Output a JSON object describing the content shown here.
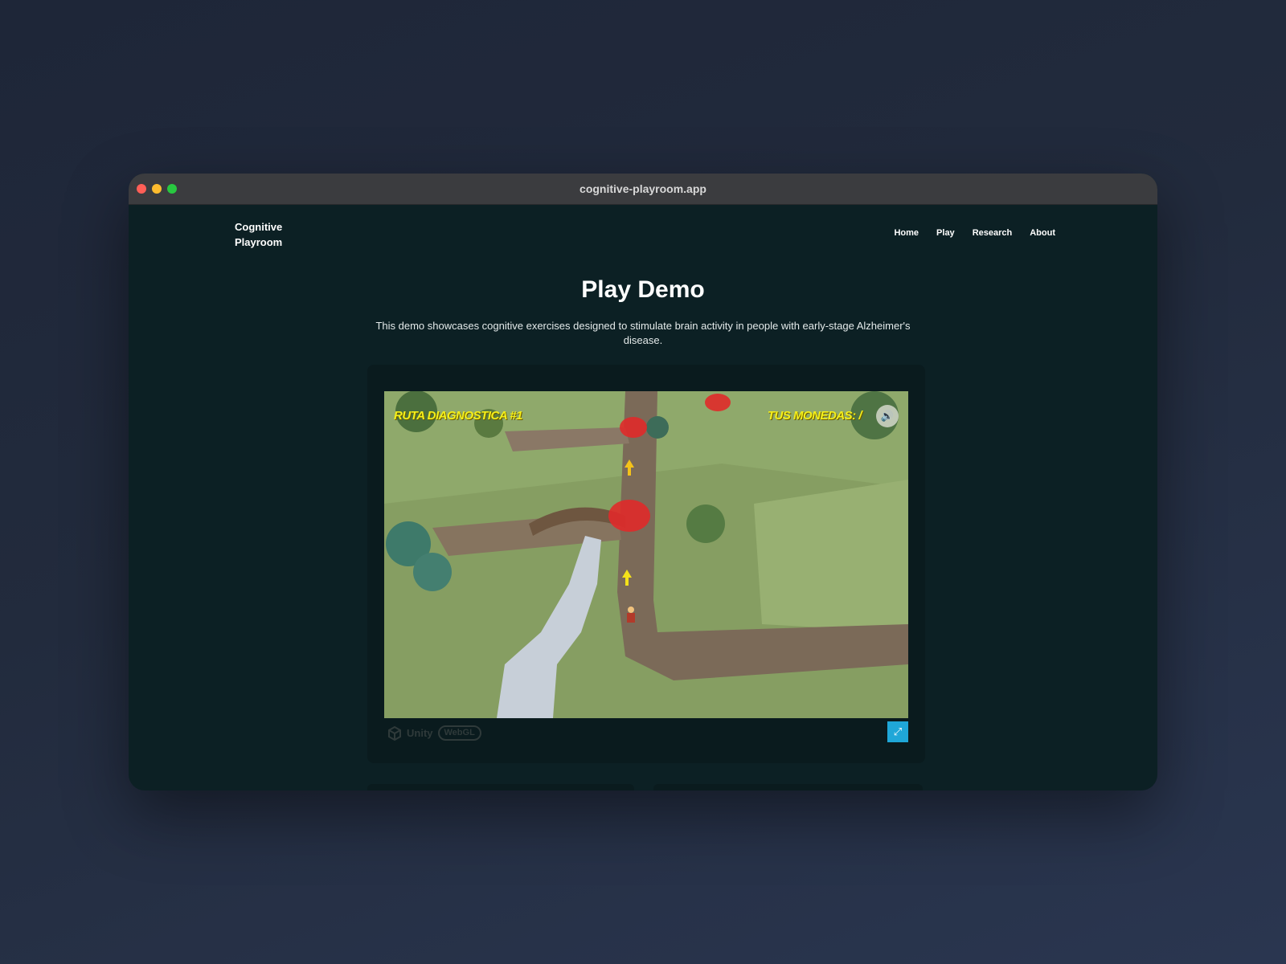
{
  "browser": {
    "url": "cognitive-playroom.app"
  },
  "header": {
    "logo_line1": "Cognitive",
    "logo_line2": "Playroom",
    "nav": [
      {
        "label": "Home"
      },
      {
        "label": "Play"
      },
      {
        "label": "Research"
      },
      {
        "label": "About"
      }
    ]
  },
  "main": {
    "title": "Play Demo",
    "description": "This demo showcases cognitive exercises designed to stimulate brain activity in people with early-stage Alzheimer's disease."
  },
  "game": {
    "hud_left": "RUTA DIAGNOSTICA #1",
    "hud_right": "TUS MONEDAS: /",
    "sound_icon": "speaker-icon",
    "footer_unity": "Unity",
    "footer_webgl": "WebGL",
    "fullscreen_icon": "fullscreen-icon"
  },
  "colors": {
    "page_bg": "#0c2024",
    "hud_text": "#f4ef1a",
    "fullscreen_button": "#1fa7d8",
    "red_ring": "#e02a2a"
  }
}
